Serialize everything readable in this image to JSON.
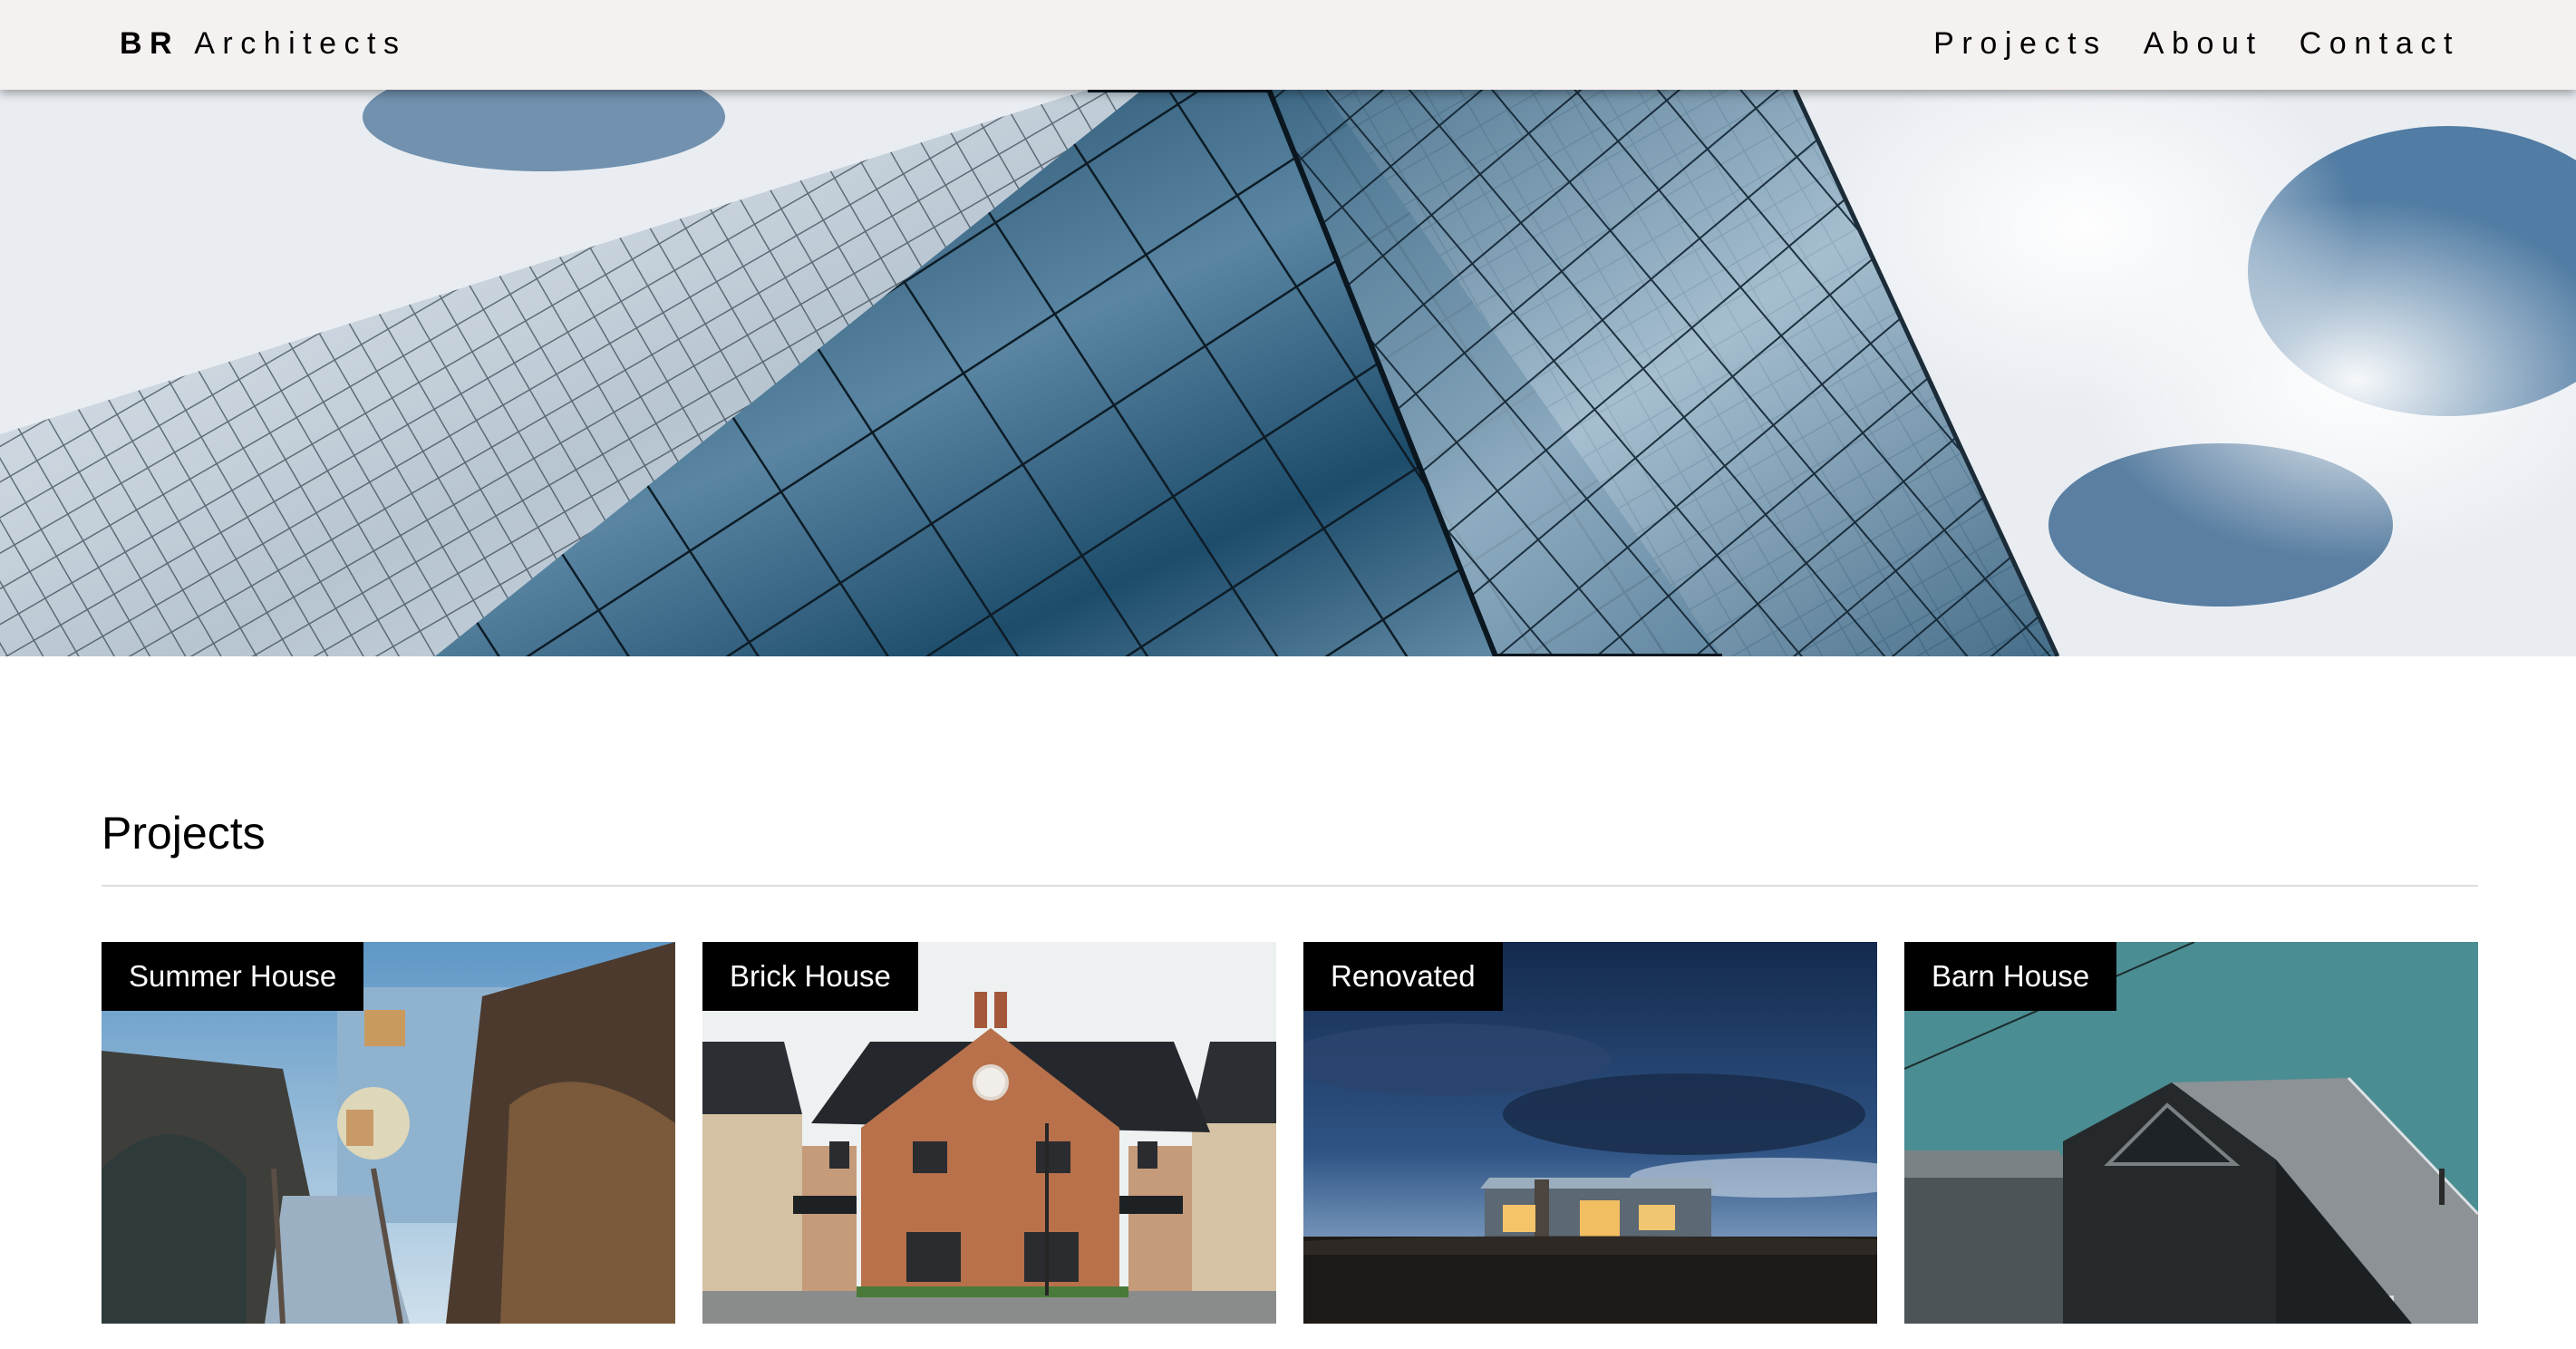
{
  "header": {
    "brand_bold": "BR",
    "brand_rest": "Architects",
    "nav": [
      "Projects",
      "About",
      "Contact"
    ]
  },
  "main": {
    "section_title": "Projects",
    "projects": [
      {
        "label": "Summer House"
      },
      {
        "label": "Brick House"
      },
      {
        "label": "Renovated"
      },
      {
        "label": "Barn House"
      }
    ]
  },
  "colors": {
    "topbar_bg": "#f4f1f0",
    "label_bg": "#000000",
    "label_text": "#ffffff"
  }
}
